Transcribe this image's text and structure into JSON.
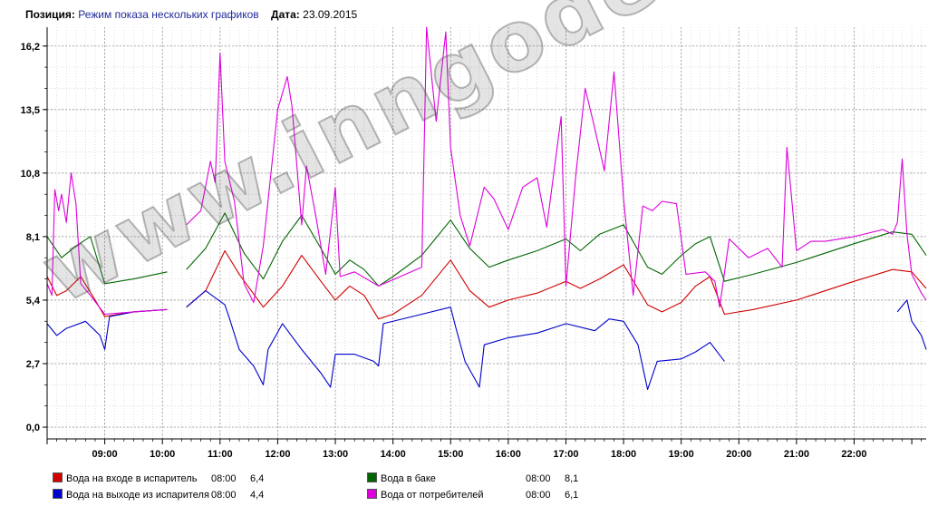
{
  "header": {
    "position_label": "Позиция:",
    "position_value": "Режим показа нескольких графиков",
    "date_label": "Дата:",
    "date_value": "23.09.2015"
  },
  "watermark": "www.inngodesign.ru",
  "chart_data": {
    "type": "line",
    "title": "",
    "xlabel": "",
    "ylabel": "",
    "x_range": [
      "08:00",
      "23:15"
    ],
    "ylim": [
      -0.5,
      17.0
    ],
    "y_ticks": [
      "0,0",
      "2,7",
      "5,4",
      "8,1",
      "10,8",
      "13,5",
      "16,2"
    ],
    "y_tick_values": [
      0.0,
      2.7,
      5.4,
      8.1,
      10.8,
      13.5,
      16.2
    ],
    "x_ticks": [
      "09:00",
      "10:00",
      "11:00",
      "12:00",
      "13:00",
      "14:00",
      "15:00",
      "16:00",
      "17:00",
      "18:00",
      "19:00",
      "20:00",
      "21:00",
      "22:00"
    ],
    "grid": true,
    "legend_position": "bottom",
    "series": [
      {
        "name": "Вода на входе в испаритель",
        "color": "#d00000",
        "legend_time": "08:00",
        "legend_value": "6,4",
        "points": [
          [
            "08:00",
            6.4
          ],
          [
            "08:10",
            5.6
          ],
          [
            "08:20",
            5.8
          ],
          [
            "08:35",
            6.4
          ],
          [
            "08:50",
            5.4
          ],
          [
            "09:00",
            4.7
          ],
          [
            "09:30",
            4.9
          ],
          [
            "10:05",
            5.0
          ],
          [
            "null",
            null
          ],
          [
            "10:25",
            5.1
          ],
          [
            "10:45",
            5.8
          ],
          [
            "11:05",
            7.5
          ],
          [
            "11:20",
            6.5
          ],
          [
            "11:45",
            5.1
          ],
          [
            "12:05",
            6.0
          ],
          [
            "12:25",
            7.3
          ],
          [
            "12:45",
            6.2
          ],
          [
            "13:00",
            5.4
          ],
          [
            "13:15",
            6.0
          ],
          [
            "13:30",
            5.6
          ],
          [
            "13:45",
            4.6
          ],
          [
            "14:00",
            4.8
          ],
          [
            "14:30",
            5.6
          ],
          [
            "15:00",
            7.1
          ],
          [
            "15:20",
            5.8
          ],
          [
            "15:40",
            5.1
          ],
          [
            "16:00",
            5.4
          ],
          [
            "16:30",
            5.7
          ],
          [
            "17:00",
            6.2
          ],
          [
            "17:15",
            5.9
          ],
          [
            "17:35",
            6.3
          ],
          [
            "18:00",
            6.9
          ],
          [
            "18:25",
            5.2
          ],
          [
            "18:40",
            4.9
          ],
          [
            "19:00",
            5.3
          ],
          [
            "19:15",
            6.0
          ],
          [
            "19:30",
            6.4
          ],
          [
            "19:45",
            4.8
          ],
          [
            "20:15",
            5.0
          ],
          [
            "21:00",
            5.4
          ],
          [
            "22:00",
            6.2
          ],
          [
            "22:40",
            6.7
          ],
          [
            "23:00",
            6.6
          ],
          [
            "23:15",
            5.9
          ]
        ]
      },
      {
        "name": "Вода на выходе из испарителя",
        "color": "#0000cc",
        "legend_time": "08:00",
        "legend_value": "4,4",
        "points": [
          [
            "08:00",
            4.4
          ],
          [
            "08:10",
            3.9
          ],
          [
            "08:20",
            4.2
          ],
          [
            "08:40",
            4.5
          ],
          [
            "08:55",
            3.9
          ],
          [
            "09:00",
            3.3
          ],
          [
            "09:05",
            4.7
          ],
          [
            "09:30",
            4.9
          ],
          [
            "10:05",
            5.0
          ],
          [
            "null",
            null
          ],
          [
            "10:25",
            5.1
          ],
          [
            "10:45",
            5.8
          ],
          [
            "11:05",
            5.2
          ],
          [
            "11:10",
            4.6
          ],
          [
            "11:20",
            3.3
          ],
          [
            "11:35",
            2.6
          ],
          [
            "11:45",
            1.8
          ],
          [
            "11:50",
            3.3
          ],
          [
            "12:05",
            4.4
          ],
          [
            "12:25",
            3.3
          ],
          [
            "12:45",
            2.3
          ],
          [
            "12:55",
            1.7
          ],
          [
            "13:00",
            3.1
          ],
          [
            "13:20",
            3.1
          ],
          [
            "13:40",
            2.8
          ],
          [
            "13:45",
            2.6
          ],
          [
            "13:50",
            4.4
          ],
          [
            "14:30",
            4.8
          ],
          [
            "15:00",
            5.1
          ],
          [
            "15:05",
            4.3
          ],
          [
            "15:15",
            2.8
          ],
          [
            "15:30",
            1.7
          ],
          [
            "15:35",
            3.5
          ],
          [
            "16:00",
            3.8
          ],
          [
            "16:30",
            4.0
          ],
          [
            "17:00",
            4.4
          ],
          [
            "17:30",
            4.1
          ],
          [
            "17:45",
            4.6
          ],
          [
            "18:00",
            4.5
          ],
          [
            "18:15",
            3.5
          ],
          [
            "18:25",
            1.6
          ],
          [
            "18:35",
            2.8
          ],
          [
            "19:00",
            2.9
          ],
          [
            "19:15",
            3.2
          ],
          [
            "19:30",
            3.6
          ],
          [
            "19:45",
            2.8
          ],
          [
            "null",
            null
          ],
          [
            "22:45",
            4.9
          ],
          [
            "22:55",
            5.4
          ],
          [
            "23:00",
            4.5
          ],
          [
            "23:10",
            3.9
          ],
          [
            "23:15",
            3.3
          ]
        ]
      },
      {
        "name": "Вода в баке",
        "color": "#006600",
        "legend_time": "08:00",
        "legend_value": "8,1",
        "points": [
          [
            "08:00",
            8.1
          ],
          [
            "08:15",
            7.2
          ],
          [
            "08:30",
            7.7
          ],
          [
            "08:45",
            8.1
          ],
          [
            "09:00",
            6.1
          ],
          [
            "09:30",
            6.3
          ],
          [
            "10:05",
            6.6
          ],
          [
            "null",
            null
          ],
          [
            "10:25",
            6.7
          ],
          [
            "10:45",
            7.6
          ],
          [
            "11:05",
            9.1
          ],
          [
            "11:25",
            7.4
          ],
          [
            "11:45",
            6.3
          ],
          [
            "12:05",
            7.9
          ],
          [
            "12:25",
            9.0
          ],
          [
            "12:45",
            7.6
          ],
          [
            "13:00",
            6.5
          ],
          [
            "13:15",
            7.1
          ],
          [
            "13:30",
            6.7
          ],
          [
            "13:45",
            6.0
          ],
          [
            "14:00",
            6.4
          ],
          [
            "14:30",
            7.3
          ],
          [
            "15:00",
            8.8
          ],
          [
            "15:20",
            7.6
          ],
          [
            "15:40",
            6.8
          ],
          [
            "16:00",
            7.1
          ],
          [
            "16:30",
            7.5
          ],
          [
            "17:00",
            8.0
          ],
          [
            "17:15",
            7.5
          ],
          [
            "17:35",
            8.2
          ],
          [
            "18:00",
            8.6
          ],
          [
            "18:25",
            6.8
          ],
          [
            "18:40",
            6.5
          ],
          [
            "19:00",
            7.3
          ],
          [
            "19:15",
            7.8
          ],
          [
            "19:30",
            8.1
          ],
          [
            "19:45",
            6.2
          ],
          [
            "20:15",
            6.5
          ],
          [
            "21:00",
            7.0
          ],
          [
            "22:00",
            7.8
          ],
          [
            "22:40",
            8.3
          ],
          [
            "23:00",
            8.2
          ],
          [
            "23:15",
            7.3
          ]
        ]
      },
      {
        "name": "Вода от потребителей",
        "color": "#dd00dd",
        "legend_time": "08:00",
        "legend_value": "6,1",
        "points": [
          [
            "08:00",
            6.1
          ],
          [
            "08:05",
            5.6
          ],
          [
            "08:08",
            10.1
          ],
          [
            "08:12",
            9.2
          ],
          [
            "08:15",
            9.9
          ],
          [
            "08:20",
            8.7
          ],
          [
            "08:25",
            10.8
          ],
          [
            "08:30",
            9.5
          ],
          [
            "08:35",
            6.1
          ],
          [
            "08:45",
            5.6
          ],
          [
            "09:00",
            4.8
          ],
          [
            "09:30",
            4.9
          ],
          [
            "10:05",
            5.0
          ],
          [
            "null",
            null
          ],
          [
            "10:25",
            8.6
          ],
          [
            "10:40",
            9.2
          ],
          [
            "10:50",
            11.3
          ],
          [
            "10:55",
            10.4
          ],
          [
            "11:00",
            15.9
          ],
          [
            "11:05",
            11.3
          ],
          [
            "11:15",
            9.6
          ],
          [
            "11:25",
            6.1
          ],
          [
            "11:35",
            5.3
          ],
          [
            "11:45",
            7.7
          ],
          [
            "12:00",
            13.5
          ],
          [
            "12:10",
            14.9
          ],
          [
            "12:15",
            13.6
          ],
          [
            "12:25",
            8.6
          ],
          [
            "12:30",
            11.1
          ],
          [
            "12:40",
            8.9
          ],
          [
            "12:50",
            6.5
          ],
          [
            "13:00",
            10.2
          ],
          [
            "13:05",
            6.4
          ],
          [
            "13:20",
            6.6
          ],
          [
            "13:45",
            6.0
          ],
          [
            "14:30",
            6.8
          ],
          [
            "14:35",
            17.0
          ],
          [
            "14:45",
            13.0
          ],
          [
            "14:55",
            16.8
          ],
          [
            "15:00",
            11.9
          ],
          [
            "15:10",
            9.0
          ],
          [
            "15:20",
            7.7
          ],
          [
            "15:35",
            10.2
          ],
          [
            "15:45",
            9.7
          ],
          [
            "16:00",
            8.4
          ],
          [
            "16:15",
            10.2
          ],
          [
            "16:30",
            10.6
          ],
          [
            "16:40",
            8.5
          ],
          [
            "16:55",
            13.2
          ],
          [
            "17:00",
            6.0
          ],
          [
            "17:10",
            10.6
          ],
          [
            "17:20",
            14.4
          ],
          [
            "17:30",
            12.7
          ],
          [
            "17:40",
            10.9
          ],
          [
            "17:50",
            15.1
          ],
          [
            "18:00",
            9.7
          ],
          [
            "18:10",
            5.6
          ],
          [
            "18:20",
            9.4
          ],
          [
            "18:30",
            9.2
          ],
          [
            "18:40",
            9.6
          ],
          [
            "18:55",
            9.5
          ],
          [
            "19:05",
            6.5
          ],
          [
            "19:25",
            6.6
          ],
          [
            "19:35",
            6.2
          ],
          [
            "19:40",
            5.1
          ],
          [
            "19:50",
            8.0
          ],
          [
            "20:10",
            7.2
          ],
          [
            "20:30",
            7.6
          ],
          [
            "20:45",
            6.8
          ],
          [
            "20:50",
            11.9
          ],
          [
            "21:00",
            7.5
          ],
          [
            "21:15",
            7.9
          ],
          [
            "21:30",
            7.9
          ],
          [
            "22:00",
            8.1
          ],
          [
            "22:30",
            8.4
          ],
          [
            "22:40",
            8.2
          ],
          [
            "22:45",
            8.7
          ],
          [
            "22:50",
            11.4
          ],
          [
            "22:55",
            8.2
          ],
          [
            "23:00",
            6.5
          ],
          [
            "23:10",
            5.7
          ],
          [
            "23:15",
            5.4
          ]
        ]
      }
    ]
  }
}
